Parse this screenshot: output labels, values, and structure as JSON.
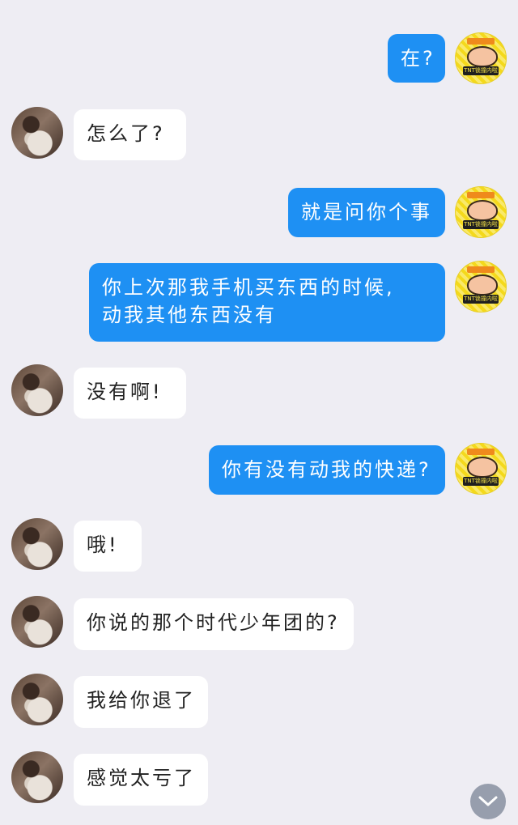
{
  "messages": [
    {
      "sender": "me",
      "text": "在?"
    },
    {
      "sender": "other",
      "text": "怎么了?"
    },
    {
      "sender": "me",
      "text": "就是问你个事"
    },
    {
      "sender": "me",
      "lines": [
        "你上次那我手机买东西的时候,",
        "动我其他东西没有"
      ]
    },
    {
      "sender": "other",
      "text": "没有啊!"
    },
    {
      "sender": "me",
      "text": "你有没有动我的快递?"
    },
    {
      "sender": "other",
      "text": "哦!"
    },
    {
      "sender": "other",
      "text": "你说的那个时代少年团的?"
    },
    {
      "sender": "other",
      "text": "我给你退了"
    },
    {
      "sender": "other",
      "text": "感觉太亏了"
    }
  ],
  "avatars": {
    "me_badge_text": "TNT锁撞内啦"
  },
  "icons": {
    "scroll_down": "chevron-down-icon"
  },
  "colors": {
    "background": "#eeedf3",
    "my_bubble": "#1e90f3",
    "other_bubble": "#ffffff",
    "scroll_button": "#8e96a6"
  }
}
